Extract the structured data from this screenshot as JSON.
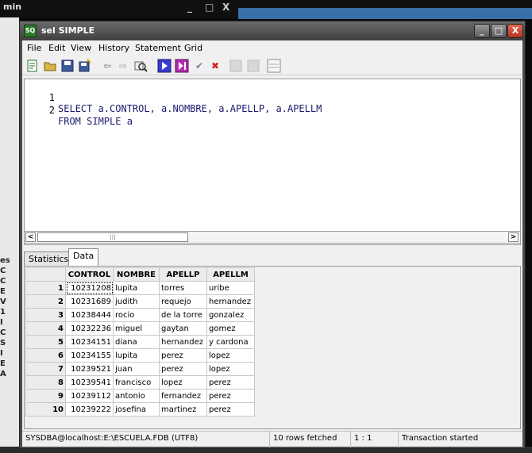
{
  "background": {
    "title_fragment": "min",
    "left_chars": [
      "es",
      "C",
      "C",
      "E",
      "V",
      "1",
      "I",
      "C",
      "S",
      "I",
      "E",
      "A"
    ]
  },
  "window": {
    "title": "sel SIMPLE",
    "icon_label": "SQ",
    "controls": {
      "minimize": "_",
      "maximize": "□",
      "close": "X"
    }
  },
  "menu": [
    "File",
    "Edit",
    "View",
    "History",
    "Statement",
    "Grid"
  ],
  "toolbar": {
    "icons": [
      "new-statement-icon",
      "open-icon",
      "save-icon",
      "save-as-icon",
      "back-icon",
      "forward-icon",
      "find-icon",
      "execute-icon",
      "execute-step-icon",
      "commit-icon",
      "rollback-icon",
      "disabled-icon",
      "disabled-icon",
      "text-view-icon"
    ]
  },
  "editor": {
    "lines": [
      {
        "no": "1",
        "code": "SELECT a.CONTROL, a.NOMBRE, a.APELLP, a.APELLM"
      },
      {
        "no": "2",
        "code": "FROM SIMPLE a"
      }
    ]
  },
  "scrollbar": {
    "left": "<",
    "right": ">",
    "grip": "|||"
  },
  "tabs": [
    "Statistics",
    "Data"
  ],
  "active_tab": "Data",
  "grid": {
    "columns": [
      "CONTROL",
      "NOMBRE",
      "APELLP",
      "APELLM"
    ],
    "rows": [
      [
        "1",
        "10231208",
        "lupita",
        "torres",
        "uribe"
      ],
      [
        "2",
        "10231689",
        "judith",
        "requejo",
        "hernandez"
      ],
      [
        "3",
        "10238444",
        "rocio",
        "de la torre",
        "gonzalez"
      ],
      [
        "4",
        "10232236",
        "miguel",
        "gaytan",
        "gomez"
      ],
      [
        "5",
        "10234151",
        "diana",
        "hernandez",
        "y cardona"
      ],
      [
        "6",
        "10234155",
        "lupita",
        "perez",
        "lopez"
      ],
      [
        "7",
        "10239521",
        "juan",
        "perez",
        "lopez"
      ],
      [
        "8",
        "10239541",
        "francisco",
        "lopez",
        "perez"
      ],
      [
        "9",
        "10239112",
        "antonio",
        "fernandez",
        "perez"
      ],
      [
        "10",
        "10239222",
        "josefina",
        "martinez",
        "perez"
      ]
    ]
  },
  "status": {
    "connection": "SYSDBA@localhost:E:\\ESCUELA.FDB (UTF8)",
    "rows_fetched": "10 rows fetched",
    "position": "1 : 1",
    "transaction": "Transaction started"
  }
}
